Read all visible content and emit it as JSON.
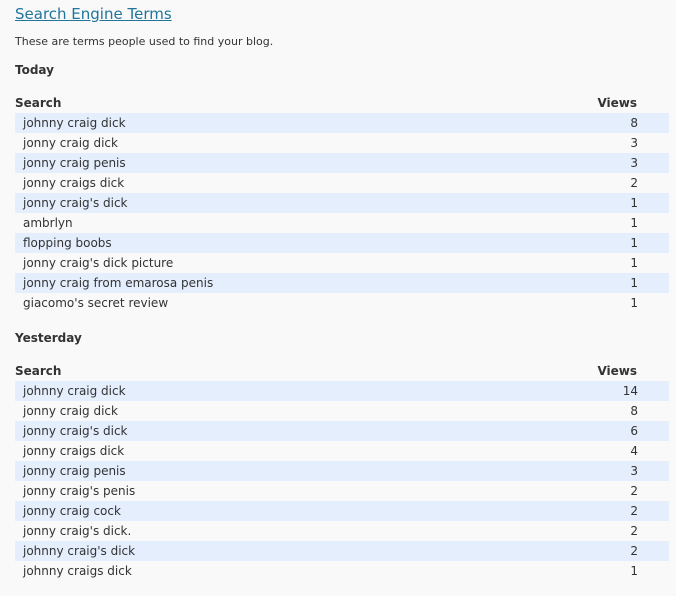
{
  "header": {
    "title": "Search Engine Terms",
    "description": "These are terms people used to find your blog."
  },
  "sections": [
    {
      "heading": "Today",
      "columns": {
        "search": "Search",
        "views": "Views"
      },
      "rows": [
        {
          "term": "johnny craig dick",
          "views": "8"
        },
        {
          "term": "jonny craig dick",
          "views": "3"
        },
        {
          "term": "jonny craig penis",
          "views": "3"
        },
        {
          "term": "jonny craigs dick",
          "views": "2"
        },
        {
          "term": "jonny craig's dick",
          "views": "1"
        },
        {
          "term": "ambrlyn",
          "views": "1"
        },
        {
          "term": "flopping boobs",
          "views": "1"
        },
        {
          "term": "jonny craig's dick picture",
          "views": "1"
        },
        {
          "term": "jonny craig from emarosa penis",
          "views": "1"
        },
        {
          "term": "giacomo's secret review",
          "views": "1"
        }
      ]
    },
    {
      "heading": "Yesterday",
      "columns": {
        "search": "Search",
        "views": "Views"
      },
      "rows": [
        {
          "term": "johnny craig dick",
          "views": "14"
        },
        {
          "term": "jonny craig dick",
          "views": "8"
        },
        {
          "term": "jonny craig's dick",
          "views": "6"
        },
        {
          "term": "jonny craigs dick",
          "views": "4"
        },
        {
          "term": "jonny craig penis",
          "views": "3"
        },
        {
          "term": "jonny craig's penis",
          "views": "2"
        },
        {
          "term": "jonny craig cock",
          "views": "2"
        },
        {
          "term": "jonny craig's dick.",
          "views": "2"
        },
        {
          "term": "johnny craig's dick",
          "views": "2"
        },
        {
          "term": "johnny craigs dick",
          "views": "1"
        }
      ]
    }
  ],
  "colors": {
    "link": "#21759b",
    "row_stripe": "#e4eefd",
    "background": "#f9f9f9"
  }
}
